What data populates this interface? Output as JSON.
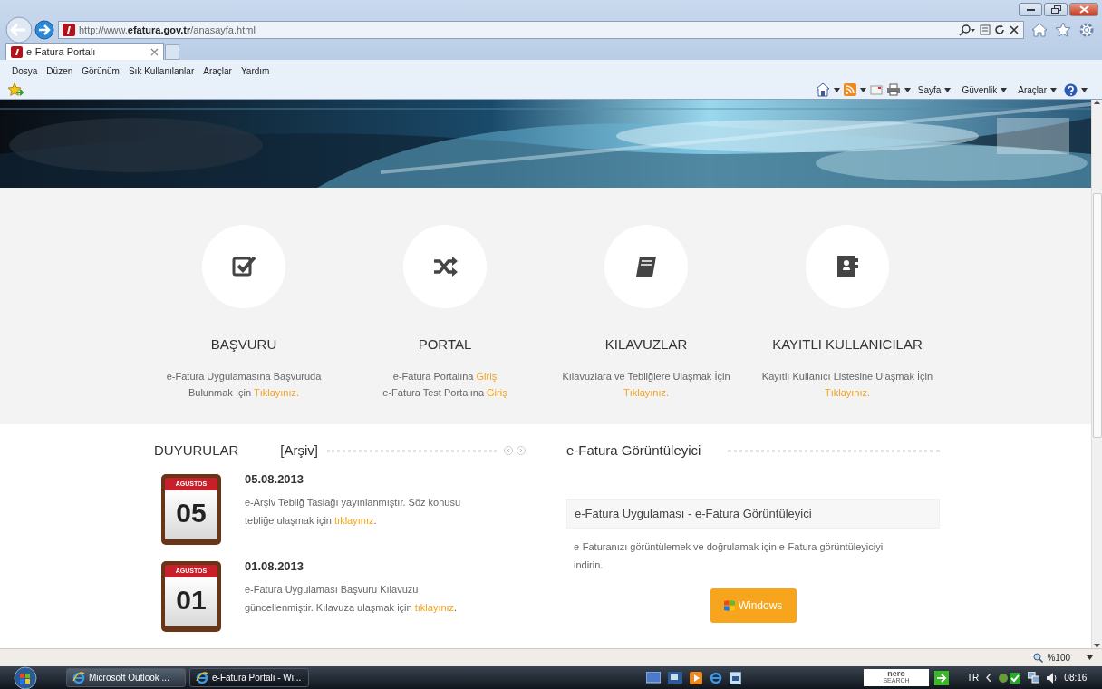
{
  "browser": {
    "address": "http://www.**efatura.gov.tr**/anasayfa.html",
    "tabs": [
      {
        "title": "e-Fatura Portalı",
        "selected": true
      }
    ],
    "menu": [
      "Dosya",
      "Düzen",
      "Görünüm",
      "Sık Kullanılanlar",
      "Araçlar",
      "Yardım"
    ],
    "command_bar": [
      "Sayfa",
      "Güvenlik",
      "Araçlar"
    ],
    "zoom": "%100"
  },
  "features": [
    {
      "kind": "check",
      "title": "BAŞVURU",
      "lines": [
        {
          "text": "e-Fatura Uygulamasına Başvuruda Bulunmak İçin ",
          "link": "Tıklayınız."
        }
      ]
    },
    {
      "kind": "shuffle",
      "title": "PORTAL",
      "lines": [
        {
          "text": "e-Fatura Portalına ",
          "link": "Giriş"
        },
        {
          "text": "e-Fatura Test Portalına ",
          "link": "Giriş"
        }
      ]
    },
    {
      "kind": "book",
      "title": "KILAVUZLAR",
      "lines": [
        {
          "text": "Kılavuzlara ve Tebliğlere Ulaşmak İçin ",
          "link": "Tıklayınız."
        }
      ]
    },
    {
      "kind": "contacts",
      "title": "KAYITLI KULLANICILAR",
      "lines": [
        {
          "text": "Kayıtlı Kullanıcı Listesine Ulaşmak İçin ",
          "link": "Tıklayınız."
        }
      ]
    }
  ],
  "announcements": {
    "title": "DUYURULAR",
    "archive": "[Arşiv]",
    "items": [
      {
        "month": "AGUSTOS",
        "day": "05",
        "date": "05.08.2013",
        "text": "e-Arşiv Tebliğ Taslağı yayınlanmıştır. Söz konusu tebliğe ulaşmak için ",
        "link": "tıklayınız",
        "tail": "."
      },
      {
        "month": "AGUSTOS",
        "day": "01",
        "date": "01.08.2013",
        "text": "e-Fatura Uygulaması Başvuru Kılavuzu güncellenmiştir. Kılavuza ulaşmak için ",
        "link": "tıklayınız",
        "tail": "."
      }
    ]
  },
  "viewer": {
    "title": "e-Fatura Görüntüleyici",
    "panel_heading": "e-Fatura Uygulaması - e-Fatura Görüntüleyici",
    "text": "e-Faturanızı görüntülemek ve doğrulamak için e-Fatura görüntüleyiciyi indirin.",
    "button": "Windows"
  },
  "taskbar": {
    "windows": [
      {
        "label": "Microsoft Outlook ...",
        "selected": false
      },
      {
        "label": "e-Fatura Portalı - Wi...",
        "selected": true
      }
    ],
    "search_logo": [
      "nero",
      "SEARCH"
    ],
    "language": "TR",
    "clock": "08:16"
  }
}
